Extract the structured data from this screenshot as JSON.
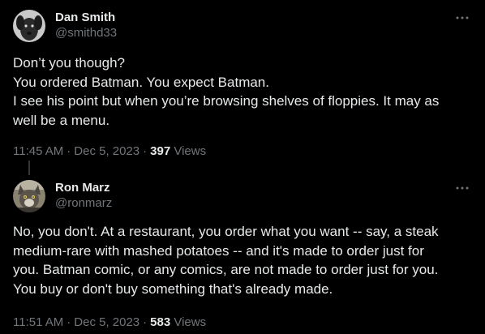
{
  "tweets": [
    {
      "display_name": "Dan Smith",
      "handle": "@smithd33",
      "avatar_icon": "dog-avatar-icon",
      "more_icon": "more-horizontal-icon",
      "lines": [
        "Don’t you though?",
        "You ordered Batman. You expect Batman.",
        "I see his point but when you’re browsing shelves of floppies. It may as",
        "well be a menu."
      ],
      "time": "11:45 AM",
      "separator": "·",
      "date": "Dec 5, 2023",
      "views_count": "397",
      "views_label": "Views"
    },
    {
      "display_name": "Ron Marz",
      "handle": "@ronmarz",
      "avatar_icon": "cat-avatar-icon",
      "more_icon": "more-horizontal-icon",
      "lines": [
        "No, you don't. At a restaurant, you order what you want -- say, a steak",
        "medium-rare with mashed potatoes -- and it's made to order just for",
        "you. Batman comic, or any comics, are not made to order just for you.",
        "You buy or don't buy something that's already made."
      ],
      "time": "11:51 AM",
      "separator": "·",
      "date": "Dec 5, 2023",
      "views_count": "583",
      "views_label": "Views"
    }
  ],
  "colors": {
    "background": "#000000",
    "primary_text": "#e7e9ea",
    "secondary_text": "#71767b",
    "thread_line": "#333639"
  }
}
